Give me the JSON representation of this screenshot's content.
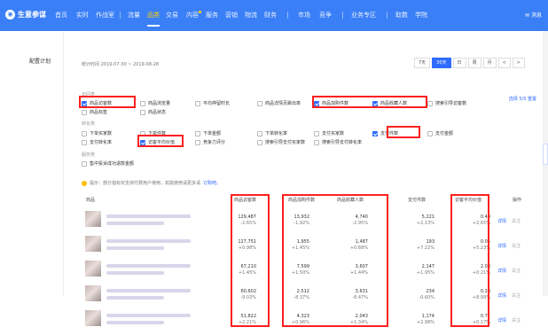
{
  "header": {
    "brand": "生意参谋",
    "nav": [
      "首页",
      "实时",
      "作战室",
      "流量",
      "品类",
      "交易",
      "内容",
      "服务",
      "营销",
      "物流",
      "财务",
      "市场",
      "竞争",
      "业务专区",
      "取数",
      "学院"
    ],
    "message": "消息"
  },
  "sidebar": {
    "item": "配置计划"
  },
  "toolbar": {
    "stat_time": "统计时间 2019-07-30 ~ 2019-08-28",
    "buttons": [
      "7天",
      "30天",
      "日",
      "周",
      "月",
      "<",
      ">"
    ]
  },
  "metrics": {
    "group1": "访问类",
    "access": [
      "商品访客数",
      "商品浏览量",
      "平均停留时长",
      "商品详情页跳出率",
      "商品加购件数",
      "商品收藏人数",
      "搜索引导访客数",
      "商品标签",
      "商品状态"
    ],
    "group2": "转化类",
    "conversion": [
      "下单买家数",
      "下单件数",
      "下单金额",
      "下单转化率",
      "支付买家数",
      "支付件数",
      "支付金额",
      "支付转化率",
      "访客平均价值",
      "竞争力评分",
      "搜索引导支付买家数",
      "搜索引导支付转化率"
    ],
    "group3": "服务类",
    "service": [
      "售中投诉成功退款金额"
    ],
    "selected_label": "选择 5/5",
    "selected_action": "重置"
  },
  "note": {
    "text": "提示：部分指标仅支持付费用户使用，如需使用请更多请",
    "link": "订购吧。"
  },
  "table": {
    "headers": [
      "商品",
      "商品访客数",
      "商品加购件数",
      "商品收藏人数",
      "支付件数",
      "访客平均价值",
      "操作"
    ],
    "rows": [
      {
        "a": "129,487",
        "ap": "-2.65%",
        "b": "13,932",
        "bp": "-1.92%",
        "c": "4,740",
        "cp": "-2.95%",
        "d": "5,221",
        "dp": "+2.13%",
        "e": "0.49",
        "ep": "+2.65%"
      },
      {
        "a": "127,751",
        "ap": "+0.98%",
        "b": "1,955",
        "bp": "+1.45%",
        "c": "1,487",
        "cp": "+0.68%",
        "d": "193",
        "dp": "+7.22%",
        "e": "0.05",
        "ep": "+5.23%"
      },
      {
        "a": "67,210",
        "ap": "+1.45%",
        "b": "7,599",
        "bp": "+1.50%",
        "c": "3,607",
        "cp": "+1.44%",
        "d": "2,147",
        "dp": "+1.95%",
        "e": "2.08",
        "ep": "+0.21%"
      },
      {
        "a": "60,602",
        "ap": "-9.03%",
        "b": "2,512",
        "bp": "-8.37%",
        "c": "3,631",
        "cp": "-8.47%",
        "d": "234",
        "dp": "-0.60%",
        "e": "0.28",
        "ep": "+8.99%"
      },
      {
        "a": "51,822",
        "ap": "+2.21%",
        "b": "4,323",
        "bp": "+0.96%",
        "c": "2,043",
        "cp": "+1.34%",
        "d": "1,174",
        "dp": "+2.98%",
        "e": "0.71",
        "ep": "+0.17%"
      }
    ],
    "detail": "详情",
    "follow": "关注"
  }
}
